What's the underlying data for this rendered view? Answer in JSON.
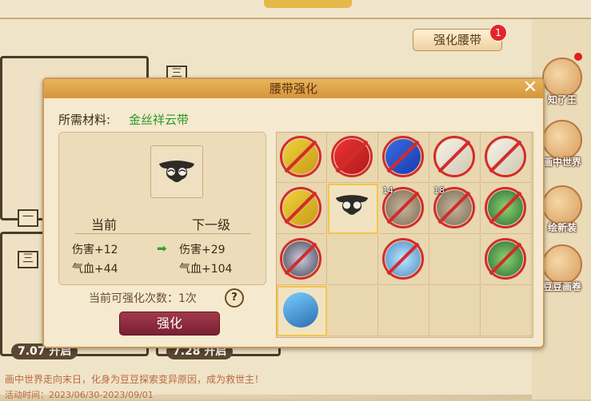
{
  "background": {
    "enhance_belt_button": "强化腰带",
    "enhance_belt_badge": "1",
    "sketch_marks": [
      "三",
      "一",
      "三"
    ],
    "start_tags": [
      "7.07 开启",
      "7.28 开启"
    ],
    "event_text": "画中世界走向末日，化身为豆豆探索变异原因，成为救世主！",
    "event_time": "活动时间：2023/06/30-2023/09/01",
    "side_buttons": [
      {
        "label": "知了王",
        "icon": "dragon-icon"
      },
      {
        "label": "画中世界",
        "icon": "scroll-icon"
      },
      {
        "label": "绘新装",
        "icon": "doll-icon"
      },
      {
        "label": "豆豆画卷",
        "icon": "painting-icon"
      }
    ]
  },
  "dialog": {
    "title": "腰带强化",
    "close": "✕",
    "required_label": "所需材料:",
    "required_value": "金丝祥云带",
    "current_head": "当前",
    "next_head": "下一级",
    "current_damage": "伤害+12",
    "current_hp": "气血+44",
    "next_damage": "伤害+29",
    "next_hp": "气血+104",
    "times_text": "当前可强化次数：1次",
    "help": "?",
    "strengthen_button": "强化",
    "inventory": [
      {
        "type": "flag-y",
        "blocked": true,
        "count": ""
      },
      {
        "type": "flag-r",
        "blocked": true,
        "count": ""
      },
      {
        "type": "flag-b",
        "blocked": true,
        "count": ""
      },
      {
        "type": "flag-w",
        "blocked": true,
        "count": ""
      },
      {
        "type": "flag-w",
        "blocked": true,
        "count": ""
      },
      {
        "type": "flag-y",
        "blocked": true,
        "count": ""
      },
      {
        "type": "belt",
        "blocked": false,
        "count": "",
        "selected": true
      },
      {
        "type": "coin",
        "blocked": true,
        "count": "14"
      },
      {
        "type": "coin",
        "blocked": true,
        "count": "18"
      },
      {
        "type": "bowl",
        "blocked": true,
        "count": ""
      },
      {
        "type": "orb",
        "blocked": true,
        "count": ""
      },
      {
        "type": "empty",
        "blocked": false,
        "count": ""
      },
      {
        "type": "crystal",
        "blocked": true,
        "count": ""
      },
      {
        "type": "empty",
        "blocked": false,
        "count": ""
      },
      {
        "type": "bowl",
        "blocked": true,
        "count": ""
      },
      {
        "type": "gem",
        "blocked": false,
        "count": "",
        "selected": true
      },
      {
        "type": "empty",
        "blocked": false,
        "count": ""
      },
      {
        "type": "empty",
        "blocked": false,
        "count": ""
      },
      {
        "type": "empty",
        "blocked": false,
        "count": ""
      },
      {
        "type": "empty",
        "blocked": false,
        "count": ""
      }
    ]
  }
}
